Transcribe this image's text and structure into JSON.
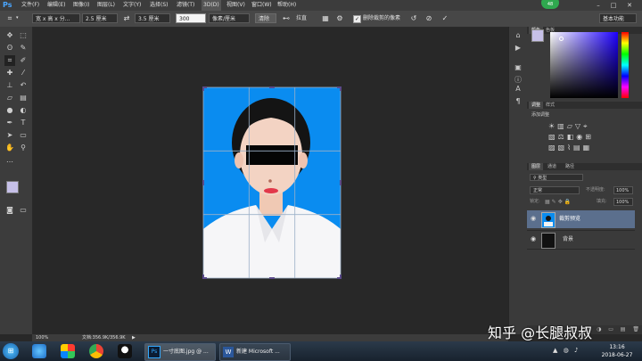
{
  "app": {
    "logo": "Ps"
  },
  "menu": [
    "文件(F)",
    "编辑(E)",
    "图像(I)",
    "图层(L)",
    "文字(Y)",
    "选择(S)",
    "滤镜(T)",
    "3D(D)",
    "视图(V)",
    "窗口(W)",
    "帮助(H)"
  ],
  "notification_badge": "48",
  "options_bar": {
    "ratio_select": "宽 x 高 x 分...",
    "width_value": "2.5 厘米",
    "height_value": "3.5 厘米",
    "resolution_value": "300",
    "unit_select": "像素/厘米",
    "clear_button": "清除",
    "straighten_label": "拉直",
    "delete_cropped_label": "删除裁剪的像素",
    "workspace_select": "基本功能"
  },
  "document": {
    "zoom": "100%",
    "doc_info": "文档:356.9K/356.9K"
  },
  "panels": {
    "color_tabs": [
      "颜色",
      "色板"
    ],
    "adjust_tabs": [
      "调整",
      "样式"
    ],
    "adjust_title": "添加调整",
    "layer_tabs": [
      "图层",
      "通道",
      "路径"
    ],
    "kind_filter": "类型",
    "blend_mode": "正常",
    "opacity_label": "不透明度:",
    "opacity_value": "100%",
    "lock_label": "锁定:",
    "fill_label": "填充:",
    "fill_value": "100%",
    "layers": [
      {
        "name": "裁剪预览"
      },
      {
        "name": "背景"
      }
    ]
  },
  "taskbar": {
    "items": [
      "一寸底图.jpg @ ...",
      "新建 Microsoft ..."
    ],
    "time": "13:16",
    "date": "2018-06-27"
  },
  "watermark": "知乎 @长腿叔叔",
  "colors": {
    "photo_bg": "#0a8cf0",
    "accent": "#4aa6ff"
  }
}
